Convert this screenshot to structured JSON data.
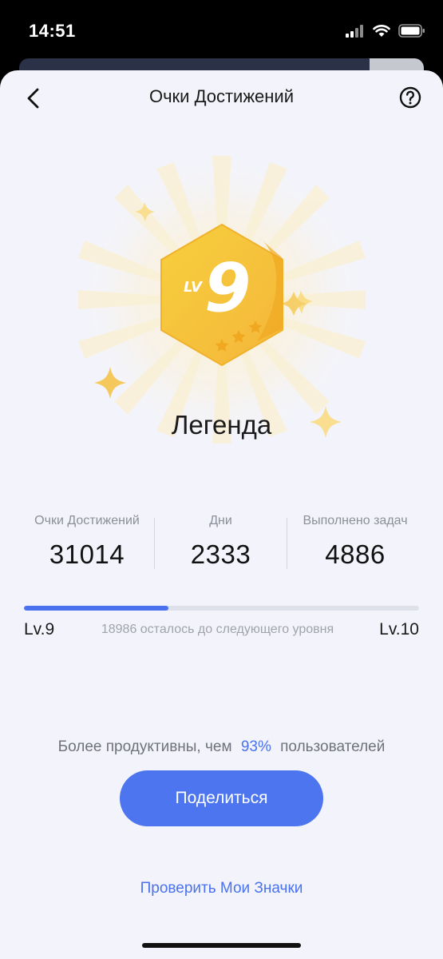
{
  "status_bar": {
    "time": "14:51"
  },
  "header": {
    "title": "Очки Достижений",
    "back_icon": "chevron-left-icon",
    "help_icon": "question-circle-icon"
  },
  "badge": {
    "prefix": "LV",
    "level": "9",
    "level_name": "Легенда",
    "accent": "#f5c23a"
  },
  "stats": [
    {
      "label": "Очки Достижений",
      "value": "31014"
    },
    {
      "label": "Дни",
      "value": "2333"
    },
    {
      "label": "Выполнено задач",
      "value": "4886"
    }
  ],
  "progress": {
    "current_level": "Lv.9",
    "next_level": "Lv.10",
    "remaining_text": "18986 осталось до следующего уровня",
    "fraction": 0.365
  },
  "productivity": {
    "prefix": "Более продуктивны, чем",
    "percent": "93%",
    "suffix": "пользователей"
  },
  "share_button": {
    "label": "Поделиться"
  },
  "badges_link": {
    "label": "Проверить Мои Значки"
  },
  "colors": {
    "accent": "#4a72ee",
    "background": "#f3f4fb"
  }
}
